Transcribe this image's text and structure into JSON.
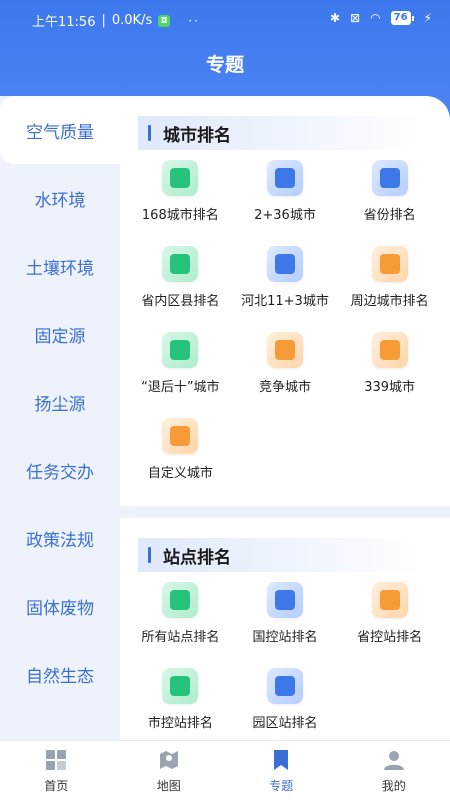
{
  "status_bar": {
    "time": "上午11:56",
    "speed": "0.0K/s",
    "dots": "··",
    "battery": "76"
  },
  "header": {
    "title": "专题"
  },
  "sidebar": {
    "items": [
      {
        "label": "空气质量",
        "active": true
      },
      {
        "label": "水环境"
      },
      {
        "label": "土壤环境"
      },
      {
        "label": "固定源"
      },
      {
        "label": "扬尘源"
      },
      {
        "label": "任务交办"
      },
      {
        "label": "政策法规"
      },
      {
        "label": "固体废物"
      },
      {
        "label": "自然生态"
      }
    ]
  },
  "sections": {
    "city": {
      "title": "城市排名",
      "items": [
        {
          "label": "168城市排名",
          "color": "green"
        },
        {
          "label": "2+36城市",
          "color": "blue"
        },
        {
          "label": "省份排名",
          "color": "blue"
        },
        {
          "label": "省内区县排名",
          "color": "green"
        },
        {
          "label": "河北11+3城市",
          "color": "blue"
        },
        {
          "label": "周边城市排名",
          "color": "orange"
        },
        {
          "label": "“退后十”城市",
          "color": "green"
        },
        {
          "label": "竞争城市",
          "color": "orange"
        },
        {
          "label": "339城市",
          "color": "orange"
        },
        {
          "label": "自定义城市",
          "color": "orange"
        }
      ]
    },
    "station": {
      "title": "站点排名",
      "items": [
        {
          "label": "所有站点排名",
          "color": "green"
        },
        {
          "label": "国控站排名",
          "color": "blue"
        },
        {
          "label": "省控站排名",
          "color": "orange"
        },
        {
          "label": "市控站排名",
          "color": "green"
        },
        {
          "label": "园区站排名",
          "color": "blue"
        }
      ]
    }
  },
  "tabbar": {
    "items": [
      {
        "label": "首页",
        "icon": "home-icon"
      },
      {
        "label": "地图",
        "icon": "map-icon"
      },
      {
        "label": "专题",
        "icon": "bookmark-icon",
        "active": true
      },
      {
        "label": "我的",
        "icon": "user-icon"
      }
    ]
  },
  "colors": {
    "primary": "#3c6fd6",
    "header": "#4d86f2"
  }
}
